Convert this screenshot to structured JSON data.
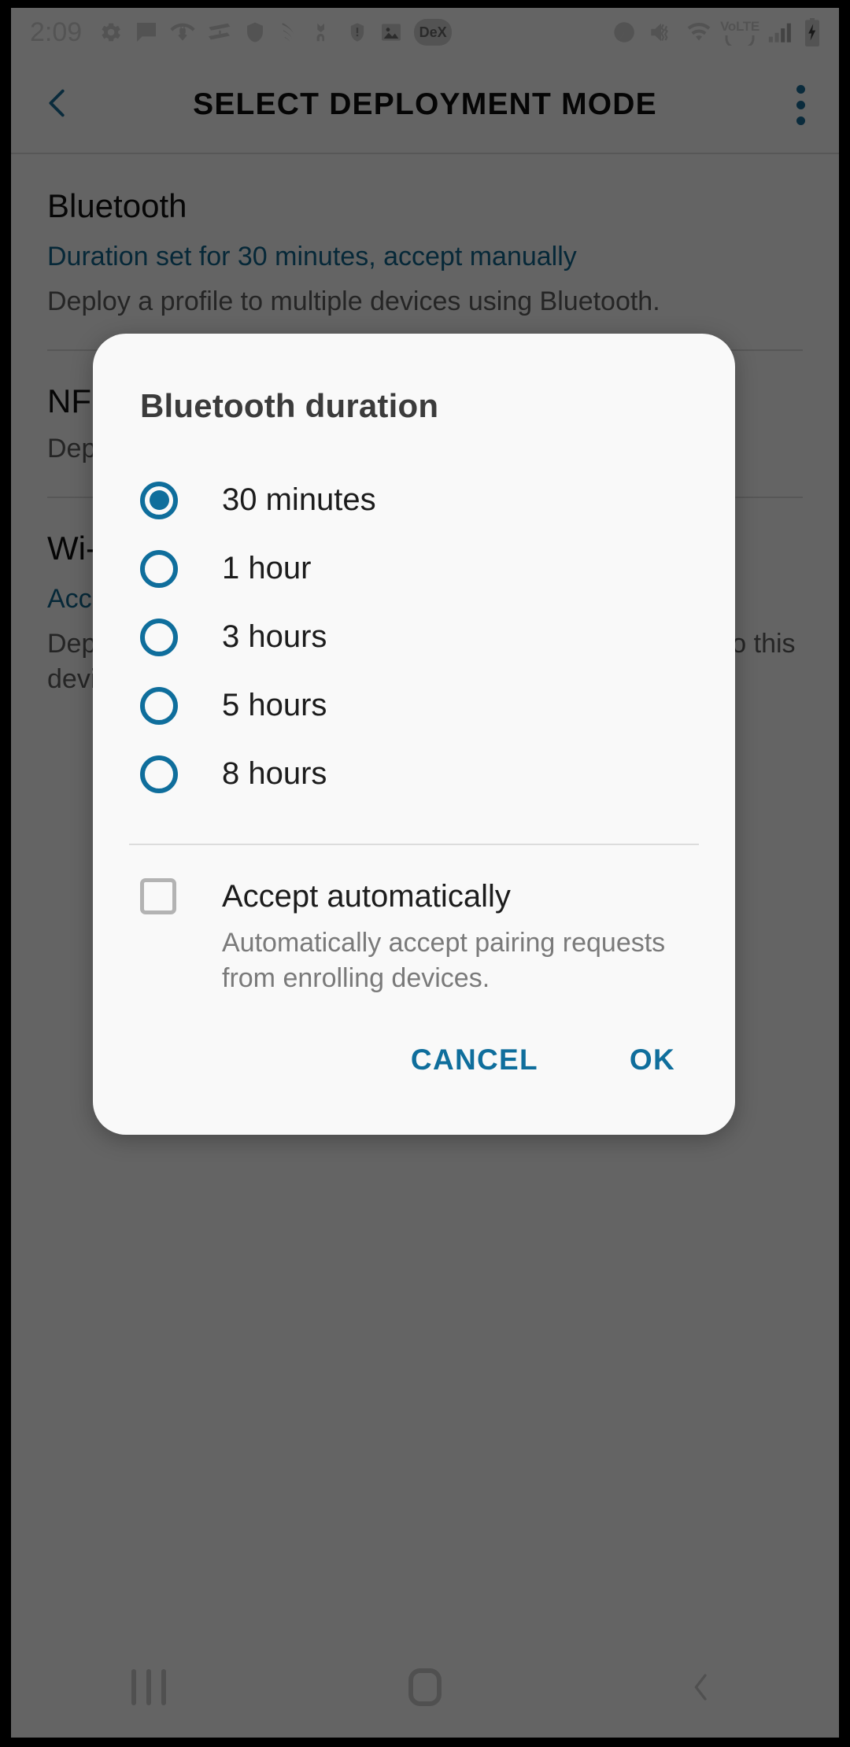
{
  "status_bar": {
    "time": "2:09",
    "left_icons": [
      "gear-icon",
      "message-bubble-icon",
      "wifi-calling-icon",
      "screen-mirror-icon",
      "shield-icon",
      "sprint-icon",
      "vpn-key-icon",
      "warning-shield-icon",
      "photo-icon",
      "dex-icon"
    ],
    "dex_label": "DeX",
    "volte_label": "VoLTE",
    "right_icons": [
      "data-saver-icon",
      "mute-vibrate-icon",
      "wifi-icon",
      "volte-icon",
      "signal-bars-icon",
      "battery-charging-icon"
    ]
  },
  "app_bar": {
    "back_icon": "back-chevron-icon",
    "title": "SELECT DEPLOYMENT MODE",
    "overflow_icon": "overflow-menu-icon"
  },
  "list": [
    {
      "title": "Bluetooth",
      "status": "Duration set for 30 minutes, accept manually",
      "description": "Deploy a profile to multiple devices using Bluetooth."
    },
    {
      "title": "NFC",
      "status": "",
      "description": "Deploy a profile to multiple devices that support NFC."
    },
    {
      "title": "Wi-Fi Direct",
      "status": "Access point name set to Knox",
      "description": "Deploy a profile to multiple devices. Devices will connect to this device running Android 3.2 or later using Wi-Fi Direct."
    }
  ],
  "dialog": {
    "title": "Bluetooth duration",
    "options": [
      {
        "label": "30 minutes",
        "selected": true
      },
      {
        "label": "1 hour",
        "selected": false
      },
      {
        "label": "3 hours",
        "selected": false
      },
      {
        "label": "5 hours",
        "selected": false
      },
      {
        "label": "8 hours",
        "selected": false
      }
    ],
    "checkbox": {
      "label": "Accept automatically",
      "checked": false,
      "help": "Automatically accept pairing requests from enrolling devices."
    },
    "cancel_label": "CANCEL",
    "ok_label": "OK"
  },
  "nav_bar": {
    "recents_icon": "recents-icon",
    "home_icon": "home-icon",
    "back_icon": "nav-back-icon"
  },
  "colors": {
    "accent": "#0f6e9c",
    "link": "#11658c",
    "dialog_bg": "#f9f9f9",
    "scrim": "rgba(0,0,0,0.60)"
  }
}
